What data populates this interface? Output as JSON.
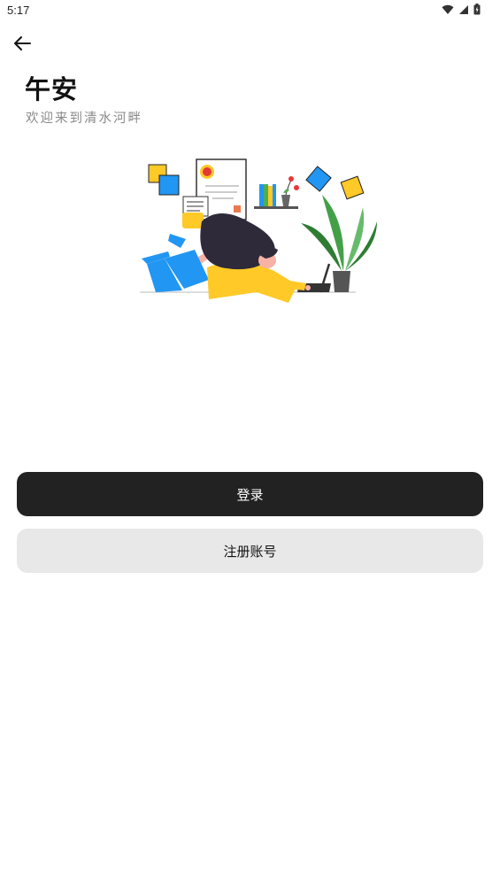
{
  "status_bar": {
    "time": "5:17",
    "icons": [
      "wifi-icon",
      "signal-icon",
      "battery-icon"
    ]
  },
  "header": {
    "back_icon": "arrow-left-icon",
    "greeting": "午安",
    "subtitle": "欢迎来到清水河畔"
  },
  "illustration": {
    "icon": "woman-with-laptop-illustration"
  },
  "actions": {
    "login_label": "登录",
    "register_label": "注册账号"
  },
  "colors": {
    "primary_button": "#222222",
    "secondary_button": "#e8e8e8",
    "subtitle_text": "#8a8a8a"
  }
}
